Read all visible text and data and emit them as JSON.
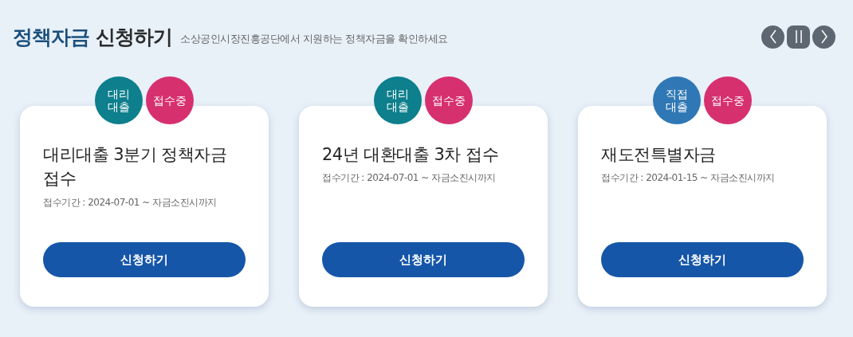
{
  "header": {
    "title_highlight": "정책자금",
    "title_rest": "신청하기",
    "subtitle": "소상공인시장진흥공단에서 지원하는 정책자금을 확인하세요"
  },
  "cards": [
    {
      "type_badge": {
        "label": "대리대출",
        "color": "#0e7f8c"
      },
      "status_badge": "접수중",
      "title": "대리대출 3분기 정책자금 접수",
      "period": "접수기간 : 2024-07-01 ~ 자금소진시까지",
      "button": "신청하기"
    },
    {
      "type_badge": {
        "label": "대리대출",
        "color": "#0e7f8c"
      },
      "status_badge": "접수중",
      "title": "24년 대환대출 3차 접수",
      "period": "접수기간 : 2024-07-01 ~ 자금소진시까지",
      "button": "신청하기"
    },
    {
      "type_badge": {
        "label": "직접대출",
        "color": "#2f78b5"
      },
      "status_badge": "접수중",
      "title": "재도전특별자금",
      "period": "접수기간 : 2024-01-15 ~ 자금소진시까지",
      "button": "신청하기"
    }
  ]
}
